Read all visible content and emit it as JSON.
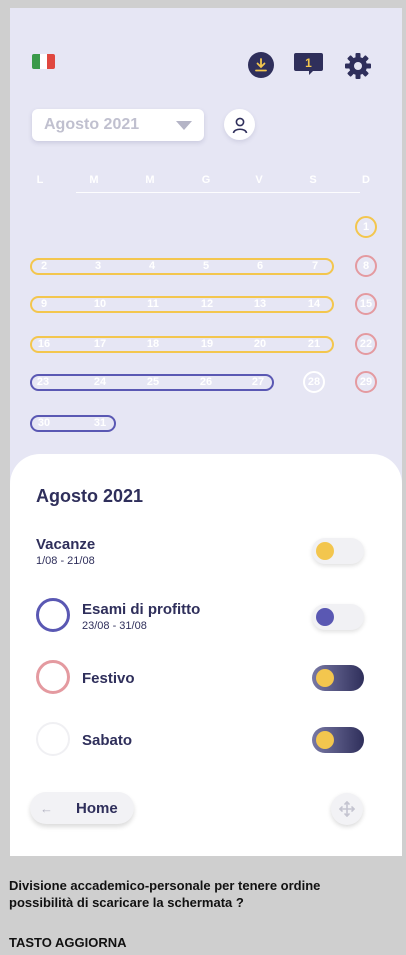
{
  "header": {
    "flag": "italy-flag",
    "notifications_count": "1",
    "icons": [
      "download-icon",
      "message-icon",
      "gear-icon"
    ]
  },
  "month_selector": {
    "label": "Agosto 2021",
    "icon": "chevron-down-icon"
  },
  "weekdays": [
    "L",
    "M",
    "M",
    "G",
    "V",
    "S",
    "D"
  ],
  "calendar_weeks": [
    [
      "",
      "",
      "",
      "",
      "",
      "",
      "1"
    ],
    [
      "2",
      "3",
      "4",
      "5",
      "6",
      "7",
      "8"
    ],
    [
      "9",
      "10",
      "11",
      "12",
      "13",
      "14",
      "15"
    ],
    [
      "16",
      "17",
      "18",
      "19",
      "20",
      "21",
      "22"
    ],
    [
      "23",
      "24",
      "25",
      "26",
      "27",
      "28",
      "29"
    ],
    [
      "30",
      "31",
      "",
      "",
      "",
      "",
      ""
    ]
  ],
  "sheet": {
    "title": "Agosto 2021",
    "vacation": {
      "title": "Vacanze",
      "dates": "1/08 - 21/08",
      "enabled": false
    },
    "exams": {
      "title": "Esami di profitto",
      "dates": "23/08 - 31/08",
      "enabled": false
    },
    "holiday": {
      "title": "Festivo",
      "enabled": true
    },
    "saturday": {
      "title": "Sabato",
      "enabled": true
    },
    "home_label": "Home"
  },
  "colors": {
    "vacation": "#f3c64e",
    "exams": "#5a58b3",
    "holiday": "#e49aa0",
    "primary": "#2f2f5b",
    "background": "#e6e6f4"
  },
  "caption": {
    "lines": [
      "Divisione accademico-personale per tenere ordine",
      "possibilità di scaricare la schermata ?"
    ],
    "footer": "TASTO AGGIORNA"
  }
}
